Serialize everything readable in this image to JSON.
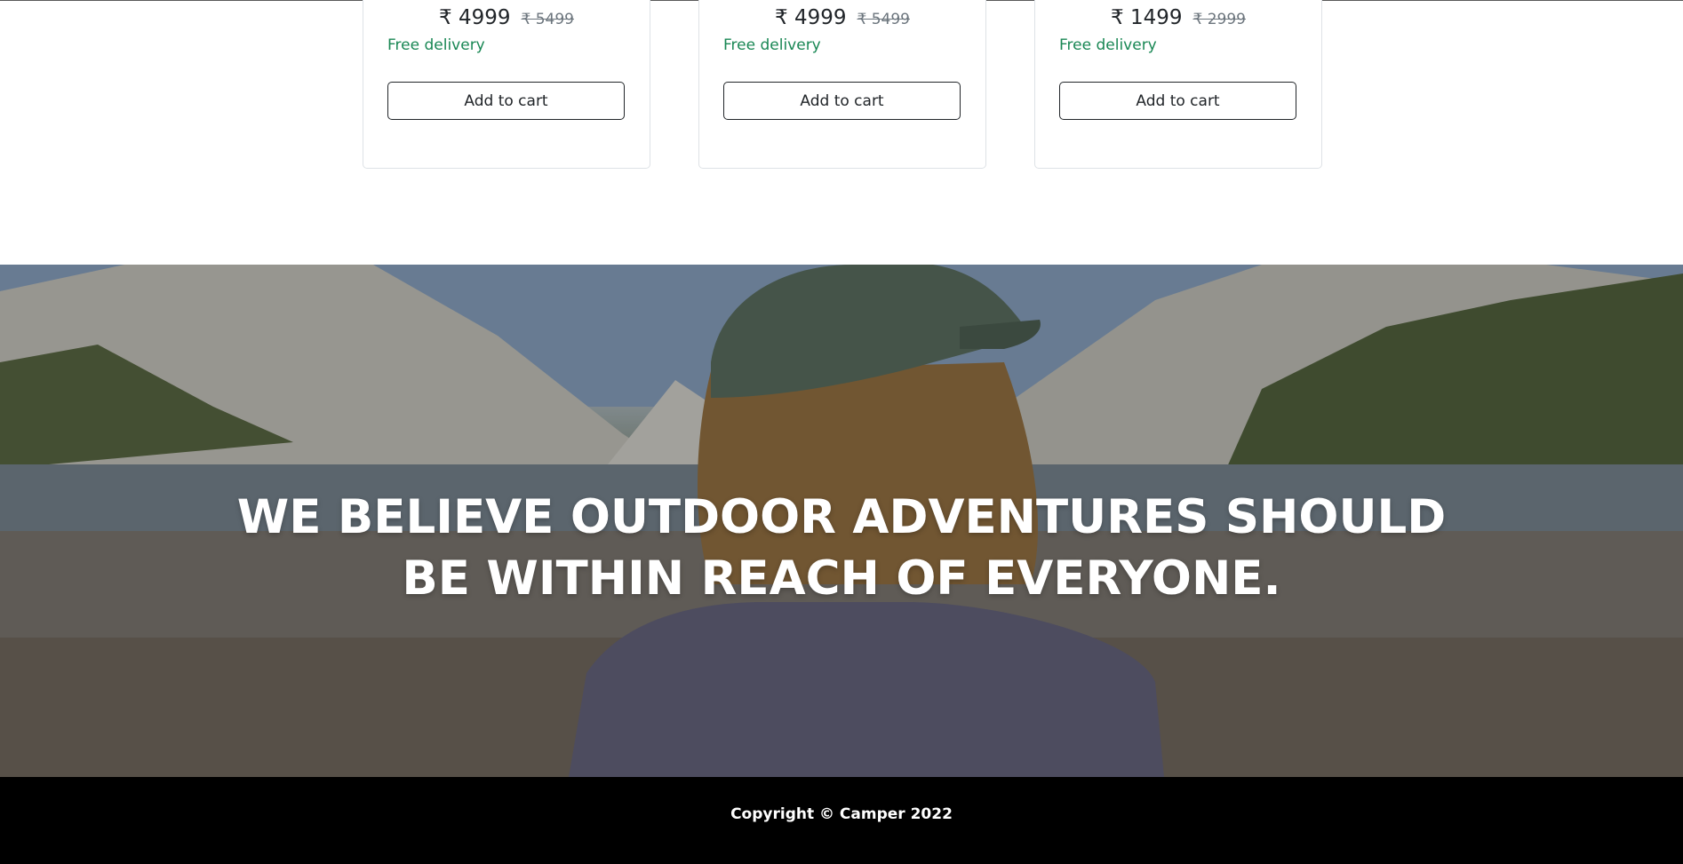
{
  "products": [
    {
      "price": "₹ 4999",
      "old_price": "₹ 5499",
      "delivery": "Free delivery",
      "cart_label": "Add to cart"
    },
    {
      "price": "₹ 4999",
      "old_price": "₹ 5499",
      "delivery": "Free delivery",
      "cart_label": "Add to cart"
    },
    {
      "price": "₹ 1499",
      "old_price": "₹ 2999",
      "delivery": "Free delivery",
      "cart_label": "Add to cart"
    }
  ],
  "hero": {
    "heading": "WE BELIEVE OUTDOOR ADVENTURES SHOULD BE WITHIN REACH OF EVERYONE.",
    "image_icon": "lake-mountain-person-photo"
  },
  "footer": {
    "copyright": "Copyright © Camper 2022"
  },
  "colors": {
    "delivery_green": "#198754",
    "footer_bg": "#000000",
    "hero_text": "#ffffff"
  }
}
